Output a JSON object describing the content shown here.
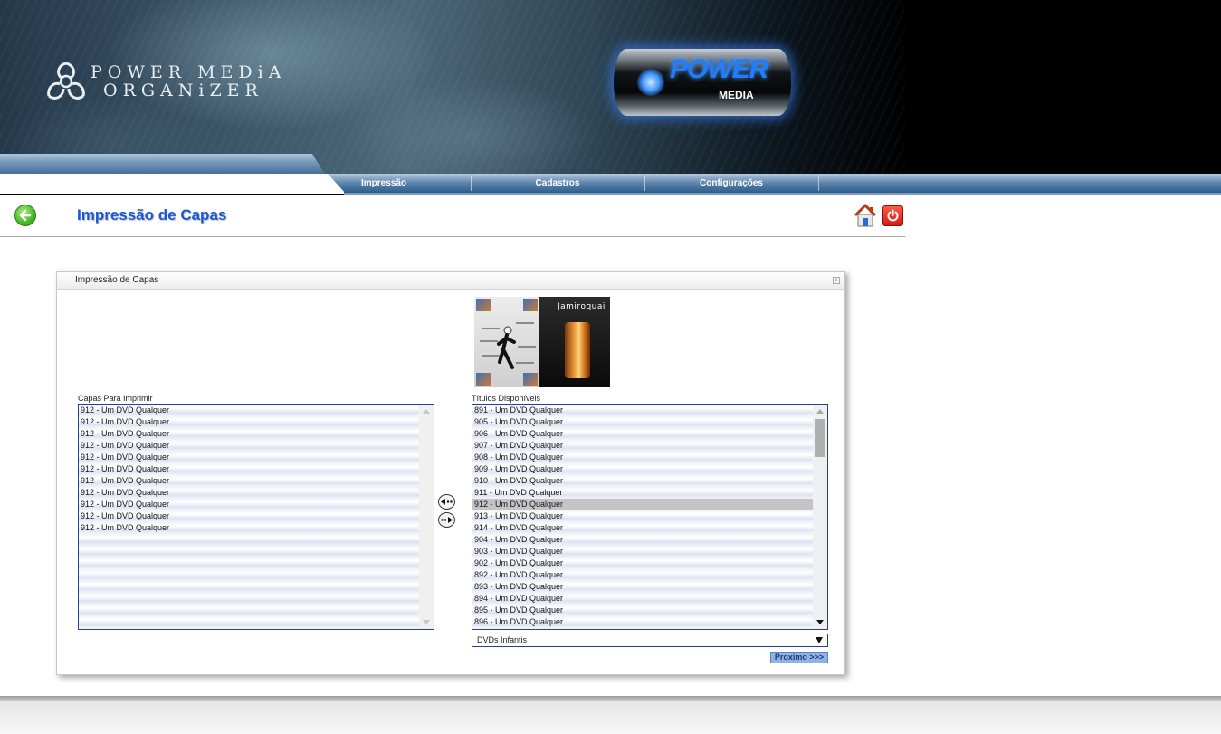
{
  "header": {
    "logo_line1": "POWER MEDiA",
    "logo_line2": "ORGANiZER",
    "can_title": "POWER",
    "can_subtitle": "MEDIA"
  },
  "nav": {
    "items": [
      {
        "label": "Impressão"
      },
      {
        "label": "Cadastros"
      },
      {
        "label": "Configurações"
      }
    ]
  },
  "page": {
    "title": "Impressão de Capas"
  },
  "panel": {
    "title": "Impressão de Capas",
    "cover_brand": "Jamiroquai",
    "left_label": "Capas Para Imprimir",
    "right_label": "Títulos Disponíveis",
    "left_items": [
      "912 - Um DVD Qualquer",
      "912 - Um DVD Qualquer",
      "912 - Um DVD Qualquer",
      "912 - Um DVD Qualquer",
      "912 - Um DVD Qualquer",
      "912 - Um DVD Qualquer",
      "912 - Um DVD Qualquer",
      "912 - Um DVD Qualquer",
      "912 - Um DVD Qualquer",
      "912 - Um DVD Qualquer",
      "912 - Um DVD Qualquer"
    ],
    "right_items": [
      "891 - Um DVD Qualquer",
      "905 - Um DVD Qualquer",
      "906 - Um DVD Qualquer",
      "907 - Um DVD Qualquer",
      "908 - Um DVD Qualquer",
      "909 - Um DVD Qualquer",
      "910 - Um DVD Qualquer",
      "911 - Um DVD Qualquer",
      "912 - Um DVD Qualquer",
      "913 - Um DVD Qualquer",
      "914 - Um DVD Qualquer",
      "904 - Um DVD Qualquer",
      "903 - Um DVD Qualquer",
      "902 - Um DVD Qualquer",
      "892 - Um DVD Qualquer",
      "893 - Um DVD Qualquer",
      "894 - Um DVD Qualquer",
      "895 - Um DVD Qualquer",
      "896 - Um DVD Qualquer"
    ],
    "right_selected": "912 - Um DVD Qualquer",
    "genre_value": "DVDs Infantis",
    "next_label": "Proximo >>>"
  },
  "colors": {
    "title_blue": "#1a56d6",
    "nav_blue": "#2f5d8b",
    "list_border": "#2a3f8f",
    "next_button": "#8fb3e6"
  },
  "icons": [
    "biohazard-logo-icon",
    "back-arrow-icon",
    "home-icon",
    "power-icon",
    "move-left-icon",
    "move-right-icon",
    "close-icon"
  ]
}
